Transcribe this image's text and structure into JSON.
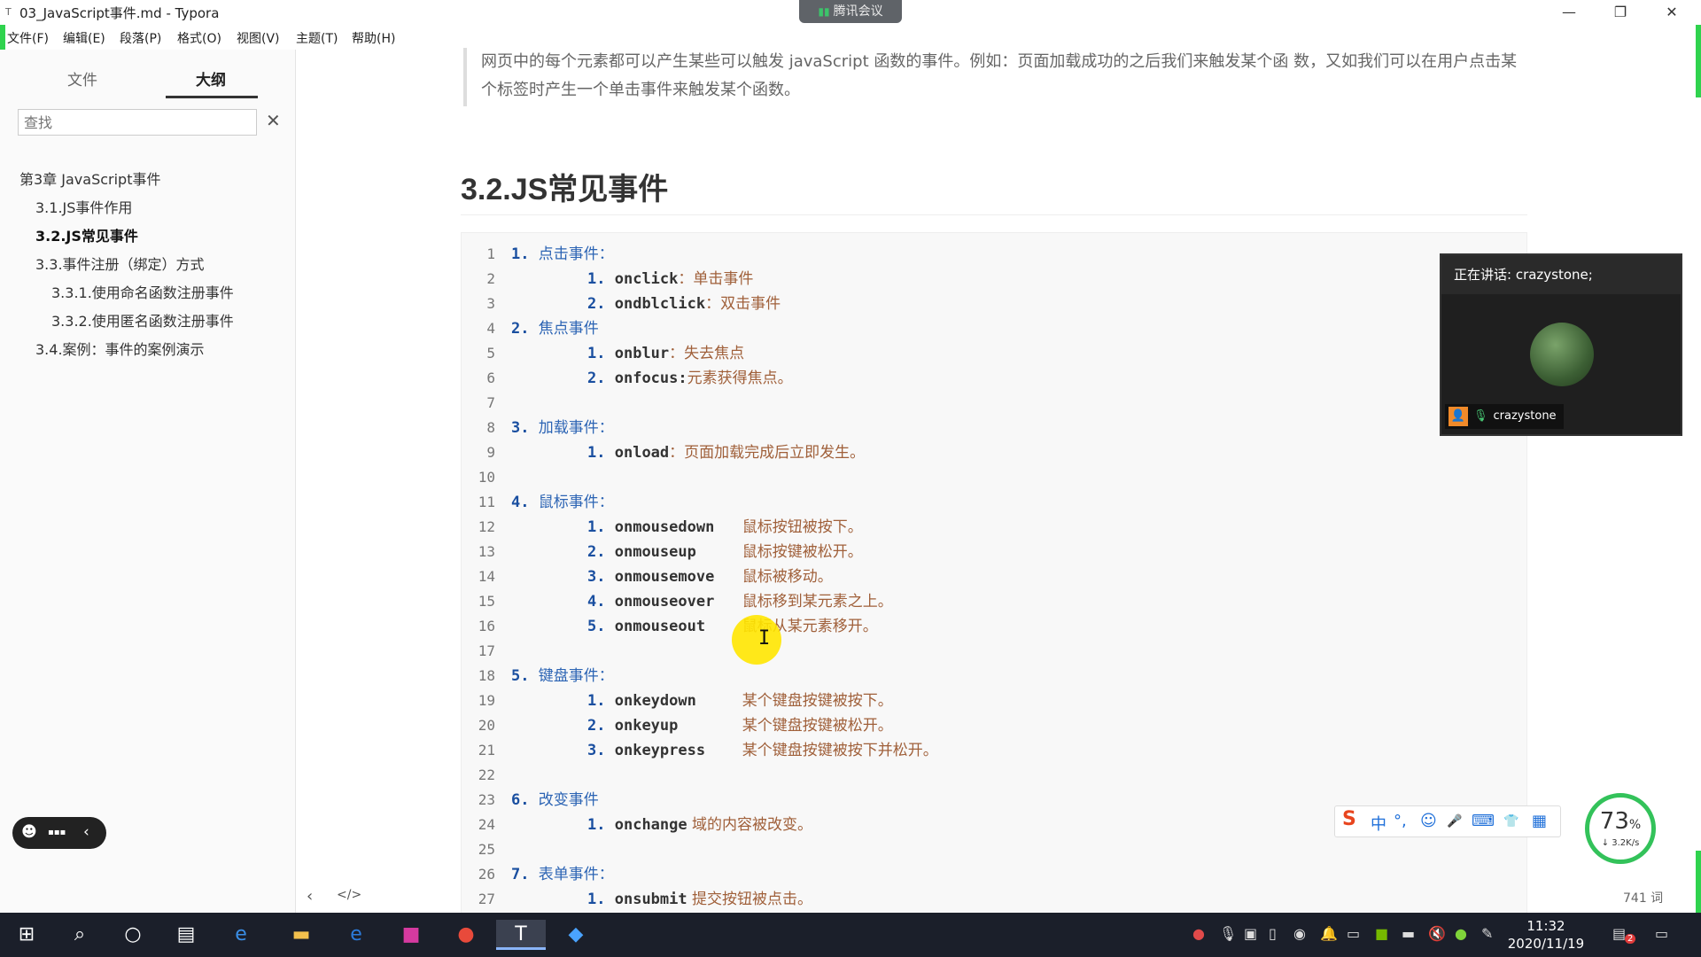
{
  "window": {
    "title": "03_JavaScript事件.md - Typora",
    "app_icon": "T",
    "minimize": "—",
    "restore": "❐",
    "close": "✕"
  },
  "meeting_pill": {
    "label": "腾讯会议",
    "signal_icon": "signal-icon"
  },
  "menu": [
    "文件(F)",
    "编辑(E)",
    "段落(P)",
    "格式(O)",
    "视图(V)",
    "主题(T)",
    "帮助(H)"
  ],
  "sidebar": {
    "tabs": [
      {
        "label": "文件",
        "active": false
      },
      {
        "label": "大纲",
        "active": true
      }
    ],
    "search_placeholder": "查找",
    "clear_icon": "✕",
    "toc": [
      {
        "label": "第3章 JavaScript事件",
        "level": 1,
        "active": false
      },
      {
        "label": "3.1.JS事件作用",
        "level": 2,
        "active": false
      },
      {
        "label": "3.2.JS常见事件",
        "level": 2,
        "active": true
      },
      {
        "label": "3.3.事件注册（绑定）方式",
        "level": 2,
        "active": false
      },
      {
        "label": "3.3.1.使用命名函数注册事件",
        "level": 3,
        "active": false
      },
      {
        "label": "3.3.2.使用匿名函数注册事件",
        "level": 3,
        "active": false
      },
      {
        "label": "3.4.案例：事件的案例演示",
        "level": 2,
        "active": false
      }
    ],
    "footer_prev": "‹",
    "footer_source": "</>"
  },
  "emoji_pill": {
    "smile": "☻",
    "chat": "▪▪▪",
    "collapse": "‹"
  },
  "editor": {
    "quote": "网页中的每个元素都可以产生某些可以触发 javaScript 函数的事件。例如：页面加载成功的之后我们来触发某个函 数，又如我们可以在用户点击某个标签时产生一个单击事件来触发某个函数。",
    "heading": "3.2.JS常见事件",
    "code_lines": [
      {
        "n": "1",
        "num": "1.",
        "head": "点击事件：",
        "indent": 0
      },
      {
        "n": "2",
        "num": "1.",
        "ev": "onclick",
        "cm": "：单击事件",
        "indent": 1
      },
      {
        "n": "3",
        "num": "2.",
        "ev": "ondblclick",
        "cm": "：双击事件",
        "indent": 1
      },
      {
        "n": "4",
        "num": "2.",
        "head": "焦点事件",
        "indent": 0
      },
      {
        "n": "5",
        "num": "1.",
        "ev": "onblur",
        "cm": "：失去焦点",
        "indent": 1
      },
      {
        "n": "6",
        "num": "2.",
        "ev": "onfocus:",
        "cm": "元素获得焦点。",
        "indent": 1
      },
      {
        "n": "7",
        "indent": 0
      },
      {
        "n": "8",
        "num": "3.",
        "head": "加载事件：",
        "indent": 0
      },
      {
        "n": "9",
        "num": "1.",
        "ev": "onload",
        "cm": "：页面加载完成后立即发生。",
        "indent": 1
      },
      {
        "n": "10",
        "indent": 0
      },
      {
        "n": "11",
        "num": "4.",
        "head": "鼠标事件：",
        "indent": 0
      },
      {
        "n": "12",
        "num": "1.",
        "ev": "onmousedown",
        "cm": "鼠标按钮被按下。",
        "indent": 1,
        "pad": true
      },
      {
        "n": "13",
        "num": "2.",
        "ev": "onmouseup",
        "cm": "鼠标按键被松开。",
        "indent": 1,
        "pad": true
      },
      {
        "n": "14",
        "num": "3.",
        "ev": "onmousemove",
        "cm": "鼠标被移动。",
        "indent": 1,
        "pad": true
      },
      {
        "n": "15",
        "num": "4.",
        "ev": "onmouseover",
        "cm": "鼠标移到某元素之上。",
        "indent": 1,
        "pad": true
      },
      {
        "n": "16",
        "num": "5.",
        "ev": "onmouseout",
        "cm": "鼠标从某元素移开。",
        "indent": 1,
        "pad": true
      },
      {
        "n": "17",
        "indent": 0
      },
      {
        "n": "18",
        "num": "5.",
        "head": "键盘事件：",
        "indent": 0
      },
      {
        "n": "19",
        "num": "1.",
        "ev": "onkeydown",
        "cm": "某个键盘按键被按下。",
        "indent": 1,
        "pad": true
      },
      {
        "n": "20",
        "num": "2.",
        "ev": "onkeyup",
        "cm": "某个键盘按键被松开。",
        "indent": 1,
        "pad": true
      },
      {
        "n": "21",
        "num": "3.",
        "ev": "onkeypress",
        "cm": "某个键盘按键被按下并松开。",
        "indent": 1,
        "pad": true
      },
      {
        "n": "22",
        "indent": 0
      },
      {
        "n": "23",
        "num": "6.",
        "head": "改变事件",
        "indent": 0
      },
      {
        "n": "24",
        "num": "1.",
        "ev": "onchange",
        "cm": " 域的内容被改变。",
        "indent": 1
      },
      {
        "n": "25",
        "indent": 0
      },
      {
        "n": "26",
        "num": "7.",
        "head": "表单事件：",
        "indent": 0
      },
      {
        "n": "27",
        "num": "1.",
        "ev": "onsubmit",
        "cm": " 提交按钮被点击。",
        "indent": 1
      }
    ],
    "word_count": "741 词"
  },
  "video_panel": {
    "speaking": "正在讲话: crazystone;",
    "name": "crazystone",
    "person_icon": "person-icon",
    "mic_icon": "mic-icon"
  },
  "ime_toolbar": {
    "logo": "S",
    "mode": "中",
    "punct": "°,",
    "items": [
      "☺",
      "🎤",
      "⌨",
      "👕",
      "▦"
    ]
  },
  "speed_gauge": {
    "percent": "73",
    "percent_unit": "%",
    "speed": "↓ 3.2K/s"
  },
  "taskbar": {
    "apps": [
      "start-icon",
      "search-icon",
      "cortana-icon",
      "task-view-icon",
      "ie-icon",
      "file-explorer-icon",
      "edge-icon",
      "intellij-icon",
      "chrome-icon",
      "typora-icon",
      "tencent-meeting-icon"
    ],
    "time": "11:32",
    "date": "2020/11/19",
    "notification_count": "2"
  },
  "colors": {
    "accent_green": "#2fd34e",
    "link_blue": "#2c64b4"
  }
}
